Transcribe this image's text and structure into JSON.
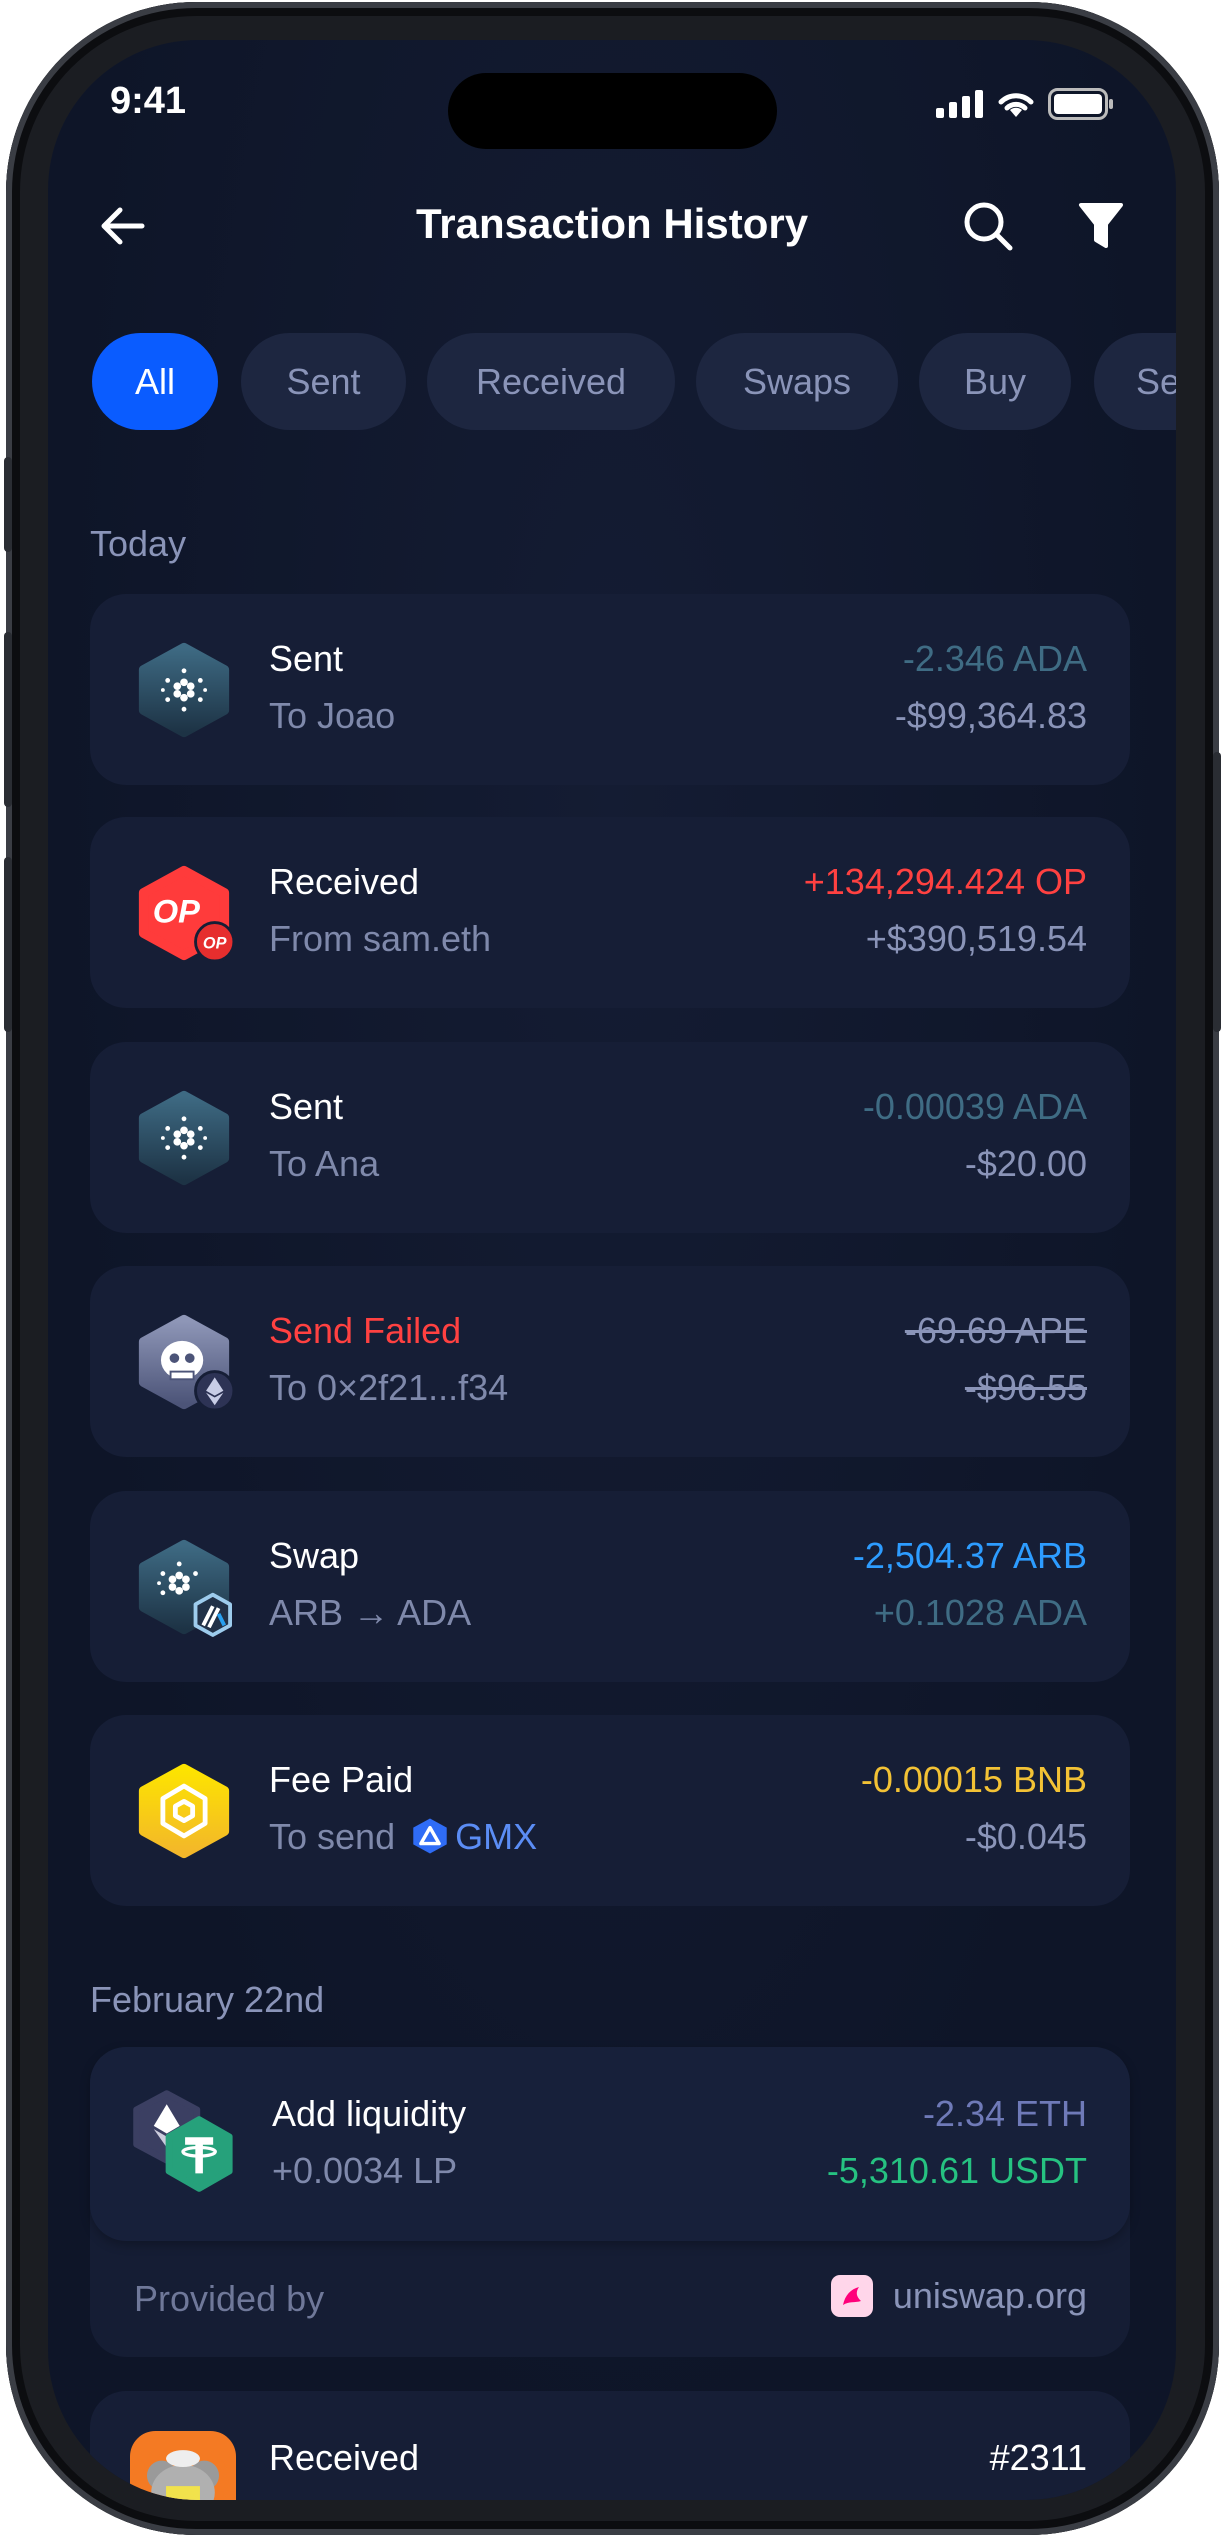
{
  "status_bar": {
    "time": "9:41"
  },
  "header": {
    "title": "Transaction History"
  },
  "filters": [
    {
      "label": "All",
      "active": true
    },
    {
      "label": "Sent"
    },
    {
      "label": "Received"
    },
    {
      "label": "Swaps"
    },
    {
      "label": "Buy"
    },
    {
      "label": "Se"
    }
  ],
  "sections": [
    {
      "label": "Today",
      "transactions": [
        {
          "title": "Sent",
          "subtitle": "To Joao",
          "amount": "-2.346 ADA",
          "fiat": "-$99,364.83",
          "icon": "cardano-icon",
          "amount_color": "#3f6c84"
        },
        {
          "title": "Received",
          "subtitle": "From sam.eth",
          "amount": "+134,294.424 OP",
          "fiat": "+$390,519.54",
          "icon": "optimism-icon",
          "amount_color": "#ff4141"
        },
        {
          "title": "Sent",
          "subtitle": "To Ana",
          "amount": "-0.00039 ADA",
          "fiat": "-$20.00",
          "icon": "cardano-icon",
          "amount_color": "#3f6c84"
        },
        {
          "title": "Send Failed",
          "subtitle": "To 0×2f21...f34",
          "amount": "-69.69 APE",
          "fiat": "-$96.55",
          "icon": "apecoin-icon",
          "title_color": "#ff4141",
          "amount_color": "#8a94b8"
        },
        {
          "title": "Swap",
          "subtitle_from": "ARB",
          "subtitle_to": "ADA",
          "amount": "-2,504.37 ARB",
          "fiat": "+0.1028 ADA",
          "icon": "cardano-arbitrum-icon",
          "amount_color": "#2d9cff",
          "fiat_color": "#3f6c84"
        },
        {
          "title": "Fee Paid",
          "subtitle": "To send",
          "token": "GMX",
          "amount": "-0.00015 BNB",
          "fiat": "-$0.045",
          "icon": "bnb-icon",
          "amount_color": "#f3c235",
          "token_color": "#5b8df5"
        }
      ]
    },
    {
      "label": "February 22nd",
      "transactions": [
        {
          "title": "Add liquidity",
          "subtitle": "+0.0034 LP",
          "amount": "-2.34 ETH",
          "fiat": "-5,310.61 USDT",
          "icon": "eth-usdt-icon",
          "amount_color": "#6f7ab8",
          "fiat_color": "#26c281",
          "provider_label": "Provided by",
          "provider": "uniswap.org"
        },
        {
          "title": "Received",
          "amount": "#2311",
          "icon": "nft-icon"
        }
      ]
    }
  ],
  "colors": {
    "accent": "#0a5cff",
    "background": "#0f1629",
    "card": "#161e36"
  }
}
